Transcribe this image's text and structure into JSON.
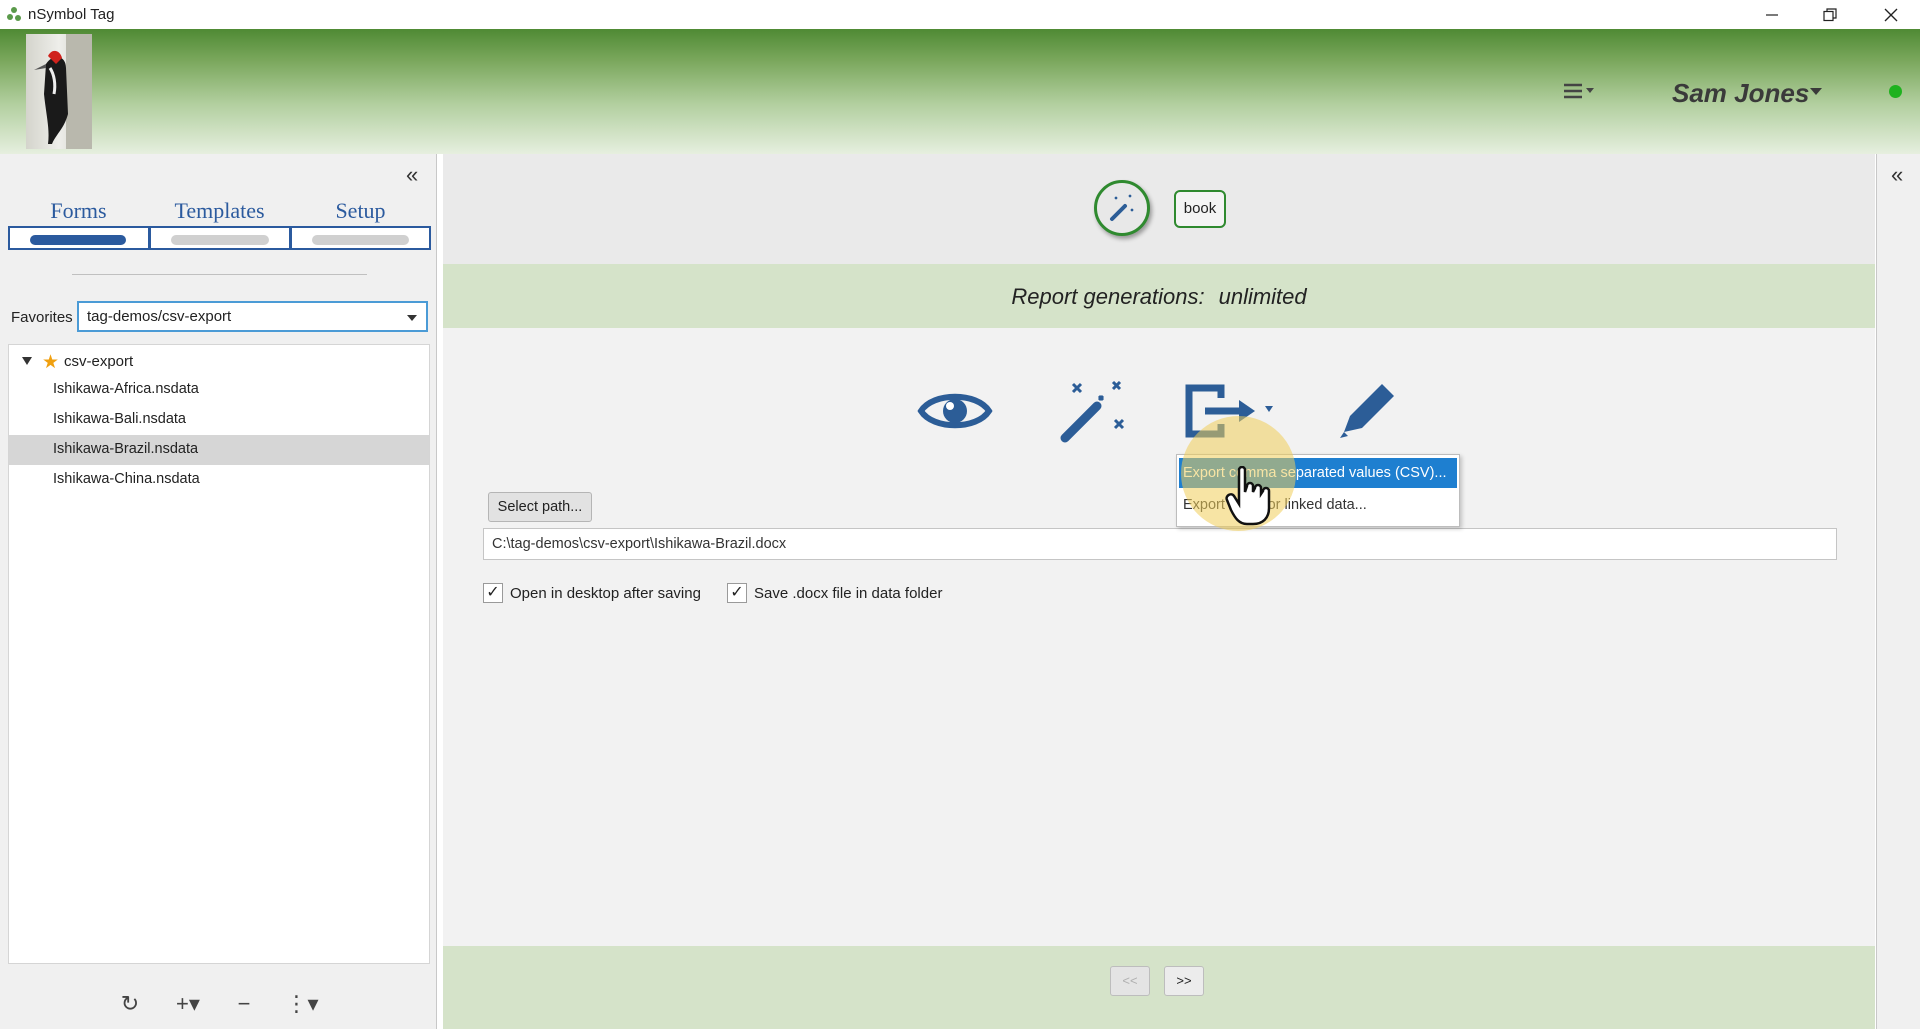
{
  "window": {
    "title": "nSymbol Tag",
    "minimize_icon": "minimize-icon",
    "maximize_icon": "restore-icon",
    "close_icon": "close-icon"
  },
  "header": {
    "user_name": "Sam Jones",
    "status_color": "#1fb21f"
  },
  "left_panel": {
    "tabs": [
      {
        "label": "Forms",
        "active": true
      },
      {
        "label": "Templates",
        "active": false
      },
      {
        "label": "Setup",
        "active": false
      }
    ],
    "favorites_label": "Favorites",
    "favorites_value": "tag-demos/csv-export",
    "tree": {
      "root_label": "csv-export",
      "items": [
        {
          "label": "Ishikawa-Africa.nsdata",
          "selected": false
        },
        {
          "label": "Ishikawa-Bali.nsdata",
          "selected": false
        },
        {
          "label": "Ishikawa-Brazil.nsdata",
          "selected": true
        },
        {
          "label": "Ishikawa-China.nsdata",
          "selected": false
        }
      ]
    },
    "tools": {
      "refresh": "↻",
      "add": "+▾",
      "remove": "−",
      "more": "⋮▾"
    }
  },
  "main": {
    "book_label": "book",
    "report_label": "Report generations:",
    "report_value": "unlimited",
    "export_menu": [
      "Export comma separated values (CSV)...",
      "Export script or linked data..."
    ],
    "select_path_label": "Select path...",
    "path_value": "C:\\tag-demos\\csv-export\\Ishikawa-Brazil.docx",
    "checkbox_open_label": "Open in desktop after saving",
    "checkbox_save_label": "Save .docx file in data folder",
    "checkbox_open_checked": "✓",
    "checkbox_save_checked": "✓",
    "prev_label": "<<",
    "next_label": ">>"
  },
  "colors": {
    "accent_blue": "#2b5a9e",
    "icon_blue": "#2c5d97",
    "highlight": "#1e7fd0",
    "band_green": "#d5e3c9",
    "banner_green": "#4f8a34"
  }
}
